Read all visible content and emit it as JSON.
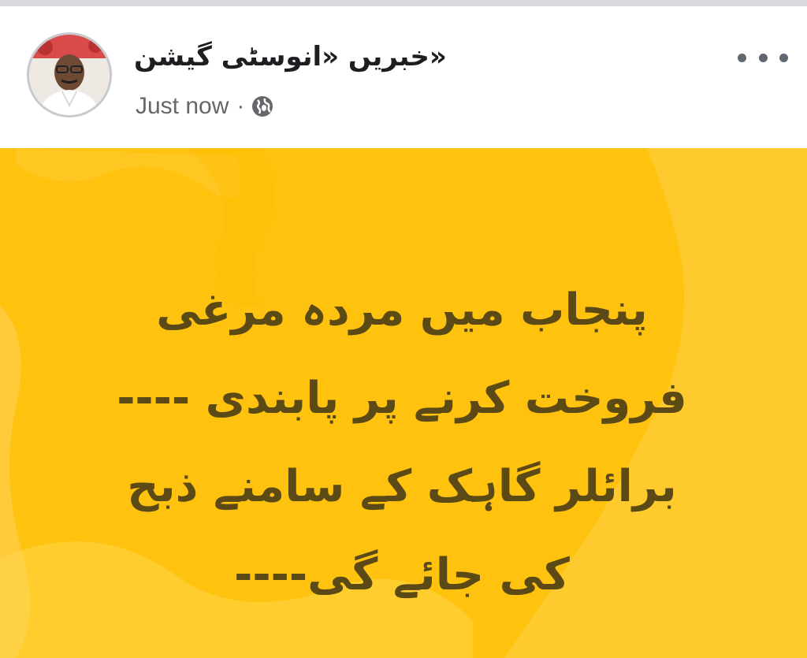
{
  "post": {
    "author_name": "«خبریں «انوسٹی گیشن",
    "timestamp": "Just now",
    "separator": "·",
    "audience_icon": "globe-icon",
    "more_icon": "more-options-icon",
    "text_lines": [
      "پنجاب میں مردہ مرغی",
      "فروخت کرنے پر پابندی ----",
      "برائلر گاہک  کے  سامنے ذبح",
      "کی جائے گی----"
    ],
    "background_color": "#ffc20e",
    "text_color": "#5b4a16"
  }
}
